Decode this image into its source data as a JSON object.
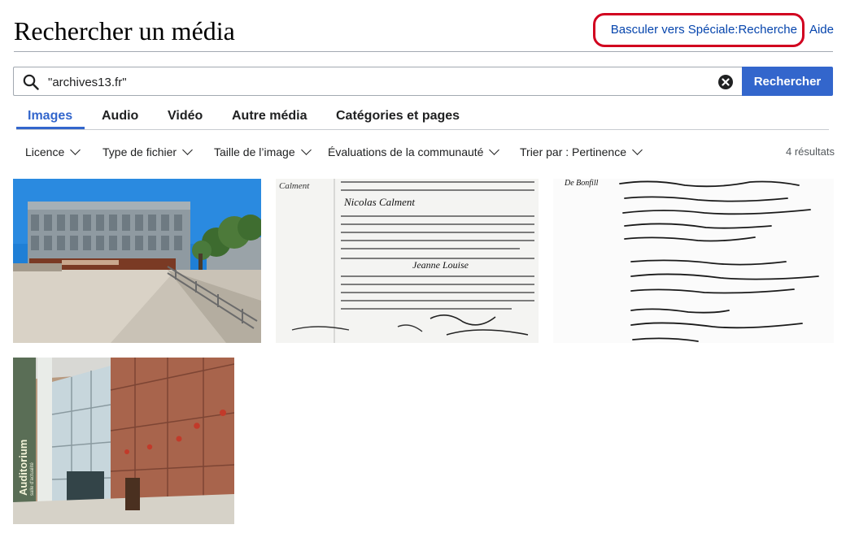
{
  "page": {
    "title": "Rechercher un média",
    "switch_link": "Basculer vers Spéciale:Recherche",
    "help_link": "Aide"
  },
  "search": {
    "value": "\"archives13.fr\"",
    "button_label": "Rechercher"
  },
  "tabs": [
    {
      "label": "Images",
      "active": true
    },
    {
      "label": "Audio",
      "active": false
    },
    {
      "label": "Vidéo",
      "active": false
    },
    {
      "label": "Autre média",
      "active": false
    },
    {
      "label": "Catégories et pages",
      "active": false
    }
  ],
  "filters": {
    "license": "Licence",
    "file_type": "Type de fichier",
    "image_size": "Taille de l’image",
    "ratings": "Évaluations de la communauté",
    "sort": "Trier par : Pertinence",
    "results_count": "4 résultats"
  },
  "results": {
    "image_1": {
      "kind": "photo",
      "subject": "archives building plaza"
    },
    "image_2": {
      "kind": "scanned-document",
      "subject": "civil register birth record"
    },
    "image_3": {
      "kind": "scanned-document",
      "subject": "handwritten manuscript list"
    },
    "image_4": {
      "kind": "photo",
      "subject": "building interior hall"
    }
  },
  "doc_text": {
    "name_a": "Nicolas Calment",
    "name_b": "Jeanne Louise",
    "margin": "Calment",
    "manuscript_head": "De Bonfill"
  },
  "interior_text": {
    "sign_main": "Auditorium",
    "sign_sub": "salle d'actualité"
  },
  "colors": {
    "accent": "#3366cc",
    "link": "#0645ad",
    "highlight": "#d1001f"
  },
  "icons": {
    "search": "magnifier",
    "clear": "circle-x",
    "dropdown": "chevron-down"
  }
}
